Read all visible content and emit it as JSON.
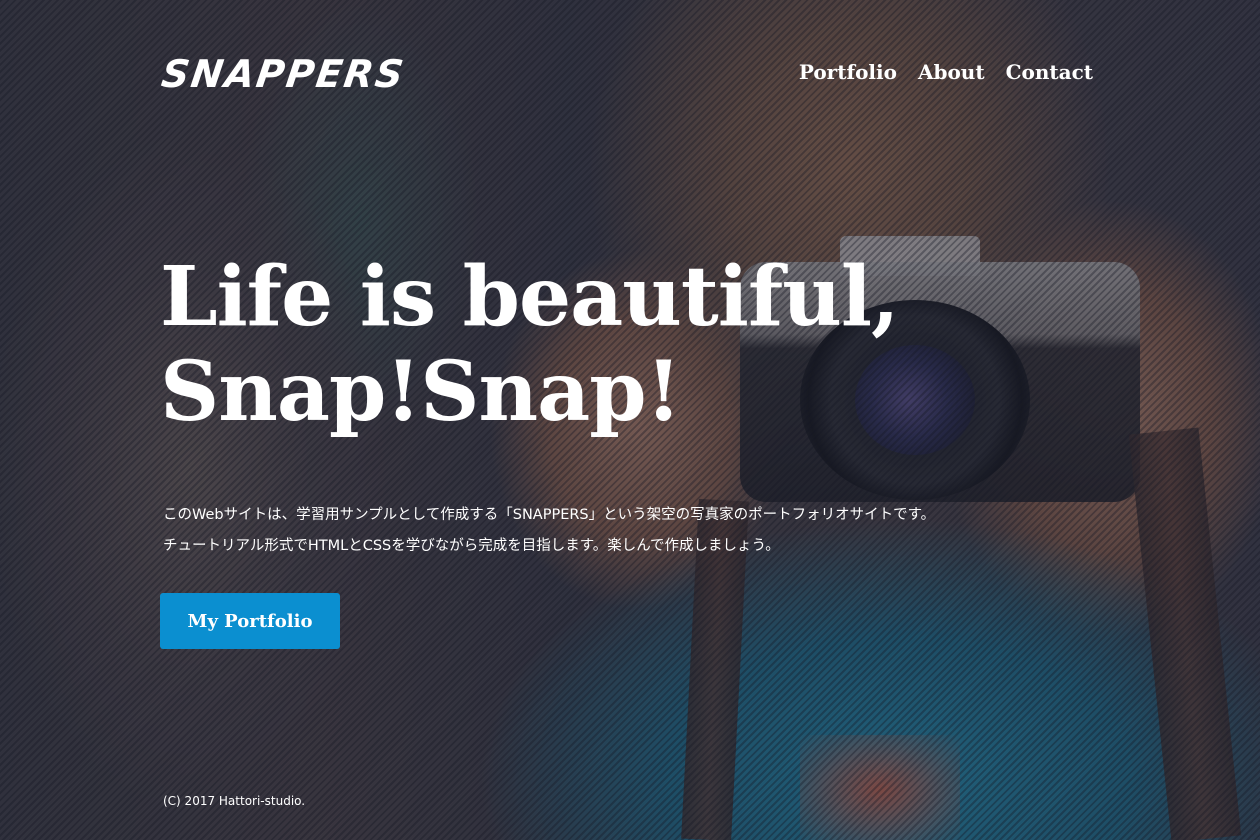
{
  "header": {
    "logo": "SNAPPERS",
    "nav": [
      {
        "label": "Portfolio"
      },
      {
        "label": "About"
      },
      {
        "label": "Contact"
      }
    ]
  },
  "hero": {
    "headline_line1": "Life is beautiful,",
    "headline_line2": "Snap!Snap!",
    "description_line1": "このWebサイトは、学習用サンプルとして作成する「SNAPPERS」という架空の写真家のポートフォリオサイトです。",
    "description_line2": "チュートリアル形式でHTMLとCSSを学びながら完成を目指します。楽しんで作成しましょう。",
    "cta_label": "My Portfolio"
  },
  "footer": {
    "copyright": "(C) 2017 Hattori-studio."
  },
  "colors": {
    "accent": "#0b8fd0",
    "text": "#ffffff"
  }
}
